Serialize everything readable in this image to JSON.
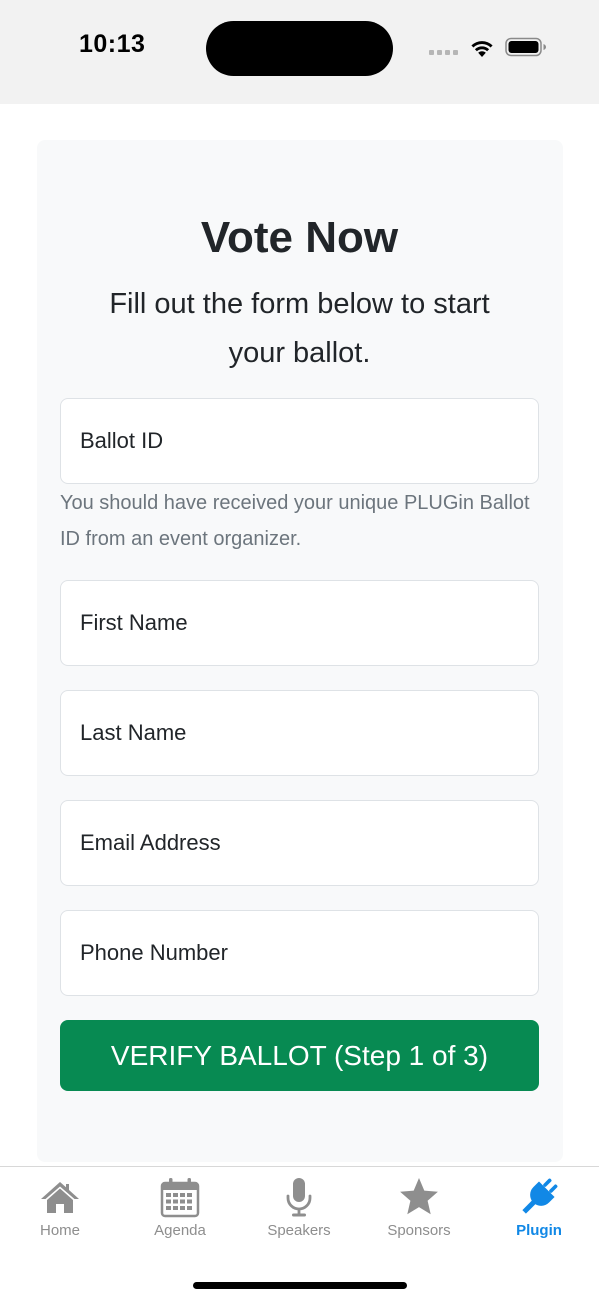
{
  "status_bar": {
    "time": "10:13"
  },
  "form": {
    "title": "Vote Now",
    "subtitle": "Fill out the form below to start your ballot.",
    "ballot_id_placeholder": "Ballot ID",
    "ballot_id_help": "You should have received your unique PLUGin Ballot ID from an event organizer.",
    "first_name_placeholder": "First Name",
    "last_name_placeholder": "Last Name",
    "email_placeholder": "Email Address",
    "phone_placeholder": "Phone Number",
    "submit_label": "VERIFY BALLOT (Step 1 of 3)"
  },
  "tab_bar": {
    "items": [
      {
        "label": "Home",
        "icon": "house-icon",
        "active": false
      },
      {
        "label": "Agenda",
        "icon": "calendar-icon",
        "active": false
      },
      {
        "label": "Speakers",
        "icon": "microphone-icon",
        "active": false
      },
      {
        "label": "Sponsors",
        "icon": "star-icon",
        "active": false
      },
      {
        "label": "Plugin",
        "icon": "plug-icon",
        "active": true
      }
    ]
  },
  "colors": {
    "primary_button": "#078a52",
    "active_tab": "#1188e6",
    "inactive_tab": "#8e8e8e",
    "card_background": "#f8f9fa",
    "help_text": "#6c757d"
  }
}
